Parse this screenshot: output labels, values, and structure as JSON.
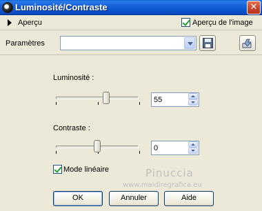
{
  "window": {
    "title": "Luminosité/Contraste",
    "close_glyph": "✕"
  },
  "preview": {
    "apercu_label": "Aperçu",
    "apercu_image_label": "Aperçu de l'image",
    "apercu_image_checked": true
  },
  "params": {
    "label": "Paramètres",
    "selected": ""
  },
  "brightness": {
    "label": "Luminosité :",
    "value": "55",
    "slider_min": -255,
    "slider_max": 255,
    "slider_value": 55
  },
  "contrast": {
    "label": "Contraste :",
    "value": "0",
    "slider_min": -100,
    "slider_max": 100,
    "slider_value": 0
  },
  "mode": {
    "label": "Mode linéaire",
    "checked": true
  },
  "watermark": {
    "title": "Pinuccia",
    "url": "www.maidiregrafica.eu"
  },
  "buttons": {
    "ok": "OK",
    "cancel": "Annuler",
    "help": "Aide"
  },
  "colors": {
    "titlebar": "#0a5fd8",
    "dialog_bg": "#ece9d8",
    "checkmark": "#21a121"
  }
}
